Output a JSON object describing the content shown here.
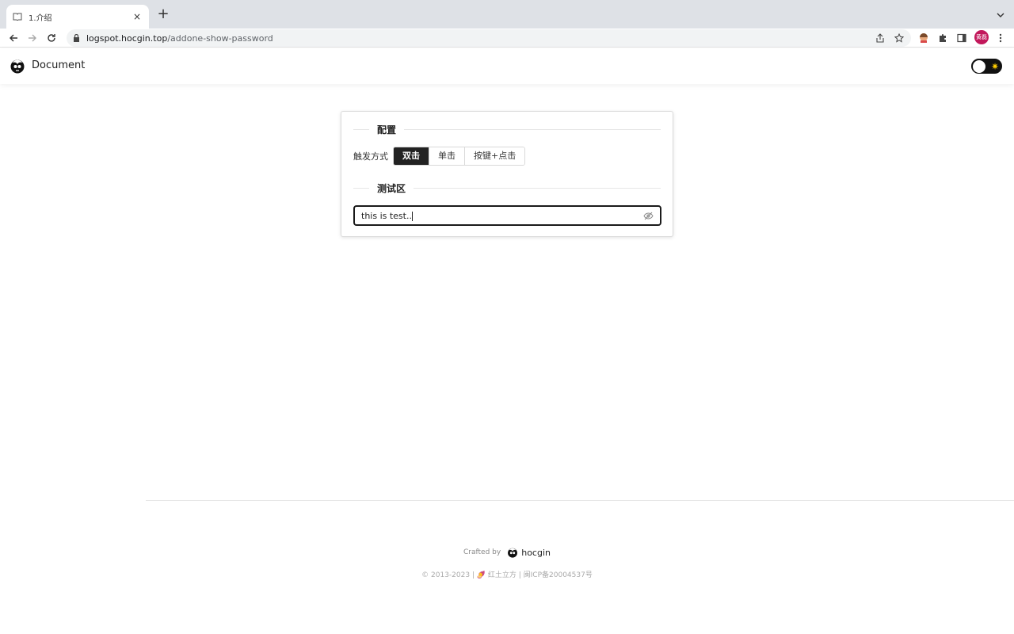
{
  "browser": {
    "tab_title": "1.介绍",
    "tab_close": "×",
    "new_tab": "+",
    "url_host": "logspot.hocgin.top",
    "url_path": "/addone-show-password",
    "profile_label": "黄磊"
  },
  "header": {
    "site_title": "Document",
    "theme_icon": "✷"
  },
  "config": {
    "section_title": "配置",
    "trigger_label": "触发方式",
    "options": [
      "双击",
      "单击",
      "按键+点击"
    ],
    "selected": "双击"
  },
  "test_area": {
    "section_title": "测试区",
    "input_value": "this is test.."
  },
  "footer": {
    "crafted_by": "Crafted by",
    "brand": "hocgin",
    "copyright": "© 2013-2023 | 🍠 红土立方 | 闽ICP备20004537号"
  },
  "colors": {
    "active_segment": "#222222",
    "profile_badge": "#c2185b",
    "sun_icon": "#ffcc00"
  }
}
